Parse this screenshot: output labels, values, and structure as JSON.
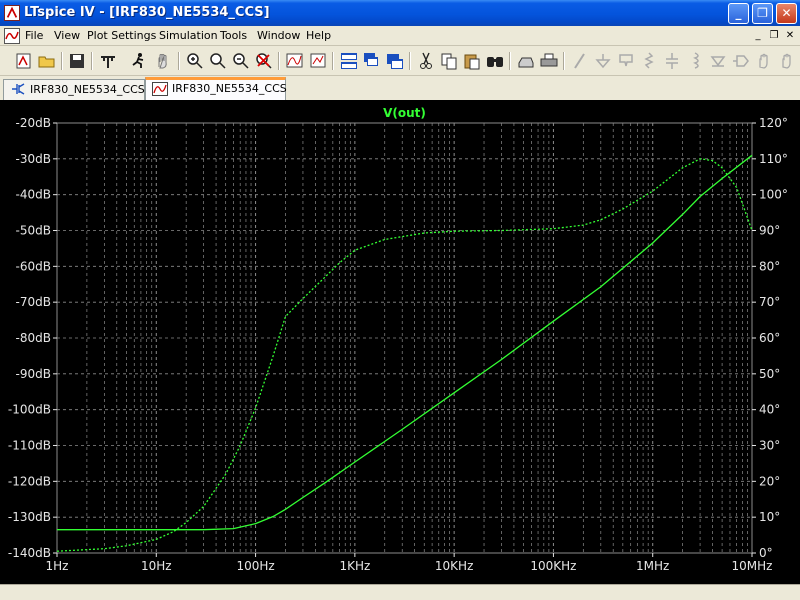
{
  "window": {
    "title": "LTspice IV - [IRF830_NE5534_CCS]",
    "minimize_glyph": "_",
    "maximize_glyph": "❐",
    "close_glyph": "✕"
  },
  "menu": {
    "items": [
      "File",
      "View",
      "Plot Settings",
      "Simulation",
      "Tools",
      "Window",
      "Help"
    ],
    "mdi_min_glyph": "_",
    "mdi_restore_glyph": "❐",
    "mdi_close_glyph": "✕"
  },
  "toolbar": {
    "icons": [
      "new-schematic-icon",
      "open-icon",
      "save-icon",
      "control-panel-icon",
      "run-icon",
      "halt-icon",
      "zoom-in-icon",
      "zoom-pan-icon",
      "zoom-out-icon",
      "zoom-cancel-icon",
      "autorange-icon",
      "zoom-fit-icon",
      "tile-horizontal-icon",
      "cascade-icon",
      "tile-vertical-icon",
      "cut-icon",
      "copy-icon",
      "find-icon",
      "print-preview-icon",
      "print-icon",
      "wire-icon",
      "ground-icon",
      "label-icon",
      "resistor-icon",
      "capacitor-icon",
      "inductor-icon",
      "diode-icon",
      "component-icon",
      "move-icon",
      "drag-icon"
    ]
  },
  "tabs": [
    {
      "label": "IRF830_NE5534_CCS",
      "icon": "schematic-icon",
      "active": false
    },
    {
      "label": "IRF830_NE5534_CCS",
      "icon": "waveform-icon",
      "active": true
    }
  ],
  "colors": {
    "plot_background": "#000000",
    "trace": "#33ff33",
    "grid": "#8c8c8c",
    "axis_text": "#e6e6e6",
    "title_text": "#33ff33"
  },
  "chart_data": {
    "type": "line",
    "title": "V(out)",
    "x_scale": "log",
    "xlim": [
      1,
      10000000
    ],
    "x_tick_labels": [
      "1Hz",
      "10Hz",
      "100Hz",
      "1KHz",
      "10KHz",
      "100KHz",
      "1MHz",
      "10MHz"
    ],
    "x_ticks": [
      1,
      10,
      100,
      1000,
      10000,
      100000,
      1000000,
      10000000
    ],
    "y_left_lim": [
      -140,
      -20
    ],
    "y_left_ticks": [
      -140,
      -130,
      -120,
      -110,
      -100,
      -90,
      -80,
      -70,
      -60,
      -50,
      -40,
      -30,
      -20
    ],
    "y_left_tick_labels": [
      "-140dB",
      "-130dB",
      "-120dB",
      "-110dB",
      "-100dB",
      "-90dB",
      "-80dB",
      "-70dB",
      "-60dB",
      "-50dB",
      "-40dB",
      "-30dB",
      "-20dB"
    ],
    "y_right_lim": [
      0,
      120
    ],
    "y_right_ticks": [
      0,
      10,
      20,
      30,
      40,
      50,
      60,
      70,
      80,
      90,
      100,
      110,
      120
    ],
    "y_right_tick_labels": [
      "0°",
      "10°",
      "20°",
      "30°",
      "40°",
      "50°",
      "60°",
      "70°",
      "80°",
      "90°",
      "100°",
      "110°",
      "120°"
    ],
    "grid": true,
    "series": [
      {
        "name": "V(out)",
        "style": "solid",
        "axis": "left",
        "x": [
          1,
          10,
          30,
          60,
          100,
          150,
          200,
          300,
          500,
          1000,
          3000,
          10000,
          30000,
          100000,
          300000,
          1000000,
          2000000,
          3000000,
          5000000,
          10000000
        ],
        "y": [
          -133.5,
          -133.5,
          -133.5,
          -133.2,
          -131.8,
          -129.8,
          -127.8,
          -124.5,
          -120.4,
          -114.6,
          -105.5,
          -95.3,
          -86.0,
          -75.3,
          -65.7,
          -53.5,
          -45.5,
          -40.5,
          -35.5,
          -29.0
        ]
      },
      {
        "style": "dotted",
        "axis": "right",
        "x": [
          1,
          3,
          5,
          10,
          15,
          20,
          30,
          50,
          70,
          100,
          150,
          200,
          300,
          500,
          700,
          1000,
          2000,
          5000,
          10000,
          30000,
          100000,
          200000,
          300000,
          500000,
          1000000,
          2000000,
          3000000,
          4000000,
          5000000,
          7000000,
          10000000
        ],
        "y": [
          0.5,
          1.2,
          2.0,
          3.8,
          6.0,
          8.5,
          13.0,
          22.0,
          30.0,
          40.5,
          55.0,
          66.0,
          71.0,
          77.0,
          81.0,
          84.5,
          87.5,
          89.3,
          89.8,
          90.0,
          90.5,
          91.5,
          93.0,
          96.0,
          101.0,
          107.5,
          110.0,
          109.5,
          107.5,
          102.0,
          90.0
        ]
      }
    ]
  }
}
